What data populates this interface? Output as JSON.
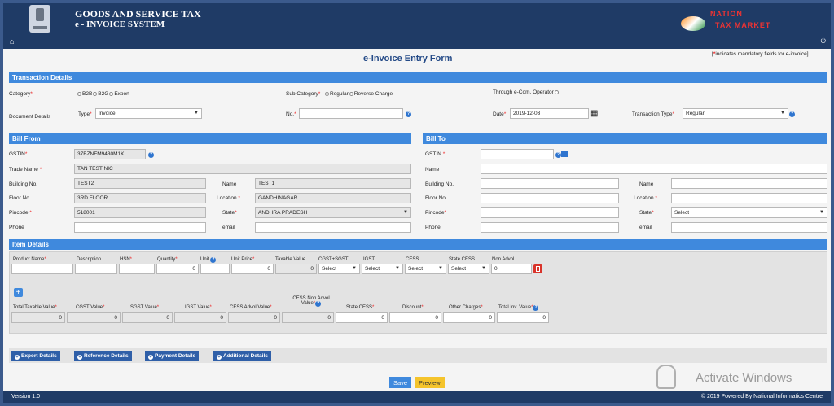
{
  "header": {
    "title_line1": "GOODS AND SERVICE TAX",
    "title_line2": "e - INVOICE SYSTEM",
    "logo_line1": "NATION",
    "logo_line2": "TAX MARKET",
    "logo_alt": "Nation Tax Market"
  },
  "nav": {
    "home": "home",
    "power": "power"
  },
  "form": {
    "title": "e-Invoice Entry Form",
    "mandatory_note": "indicates mandatory fields for e-invoice"
  },
  "transaction": {
    "heading": "Transaction Details",
    "category_label": "Category",
    "category_options": [
      "B2B",
      "B2G",
      "Export"
    ],
    "subcategory_label": "Sub Category",
    "subcategory_options": [
      "Regular",
      "Reverse Charge"
    ],
    "ecom_label": "Through e-Com. Operator",
    "doc_details_label": "Document Details",
    "type_label": "Type",
    "type_value": "Invoice",
    "no_label": "No.",
    "no_value": "",
    "date_label": "Date",
    "date_value": "2019-12-03",
    "trans_type_label": "Transaction Type",
    "trans_type_value": "Regular"
  },
  "bill_from": {
    "heading": "Bill From",
    "gstin_label": "GSTIN",
    "gstin": "37BZNFM9430M1KL",
    "trade_name_label": "Trade Name",
    "trade_name": "TAN TEST NIC",
    "building_label": "Building No.",
    "building": "TEST2",
    "name_label": "Name",
    "name": "TEST1",
    "floor_label": "Floor No.",
    "floor": "3RD FLOOR",
    "location_label": "Location",
    "location": "GANDHINAGAR",
    "pincode_label": "Pincode",
    "pincode": "518001",
    "state_label": "State",
    "state": "ANDHRA PRADESH",
    "phone_label": "Phone",
    "phone": "",
    "email_label": "email",
    "email": ""
  },
  "bill_to": {
    "heading": "Bill To",
    "gstin_label": "GSTIN",
    "gstin": "",
    "name_label": "Name",
    "building_label": "Building No.",
    "name2_label": "Name",
    "floor_label": "Floor No.",
    "location_label": "Location",
    "pincode_label": "Pincode",
    "state_label": "State",
    "state": "Select",
    "phone_label": "Phone",
    "email_label": "email"
  },
  "items": {
    "heading": "Item Details",
    "col_product": "Product Name",
    "col_desc": "Description",
    "col_hsn": "HSN",
    "col_qty": "Quantity",
    "col_unit": "Unit",
    "col_price": "Unit Price",
    "col_taxable": "Taxable Value",
    "col_cgst": "CGST+SGST",
    "col_igst": "IGST",
    "col_cess": "CESS",
    "col_state_cess": "State CESS",
    "col_non_advol": "Non Advol",
    "qty": "0",
    "price": "0",
    "taxable": "0",
    "cgst": "Select",
    "igst": "Select",
    "cess": "Select",
    "state_cess": "Select",
    "non_advol": "0",
    "add_label": "+",
    "tot_taxable": "Total Taxable Value",
    "tot_cgst": "CGST Value",
    "tot_sgst": "SGST Value",
    "tot_igst": "IGST Value",
    "tot_cess_advol": "CESS Advol Value",
    "tot_cess_non_line1": "CESS Non Advol",
    "tot_cess_non_line2": "Value",
    "tot_state_cess": "State CESS",
    "tot_discount": "Discount",
    "tot_other": "Other Charges",
    "tot_inv": "Total Inv. Value",
    "v_taxable": "0",
    "v_cgst": "0",
    "v_sgst": "0",
    "v_igst": "0",
    "v_cess_advol": "0",
    "v_cess_non": "0",
    "v_state_cess": "0",
    "v_discount": "0",
    "v_other": "0",
    "v_inv": "0"
  },
  "tabs": [
    "Export Details",
    "Reference Details",
    "Payment Details",
    "Additional Details"
  ],
  "buttons": {
    "save": "Save",
    "preview": "Preview"
  },
  "footer": {
    "version": "Version 1.0",
    "copyright": "© 2019 Powered By National Informatics Centre"
  },
  "watermark": "Activate Windows",
  "colors": {
    "header": "#1f3b66",
    "section": "#3f89dd",
    "save": "#3f89dd",
    "preview": "#f5c42c",
    "required": "#e22"
  }
}
